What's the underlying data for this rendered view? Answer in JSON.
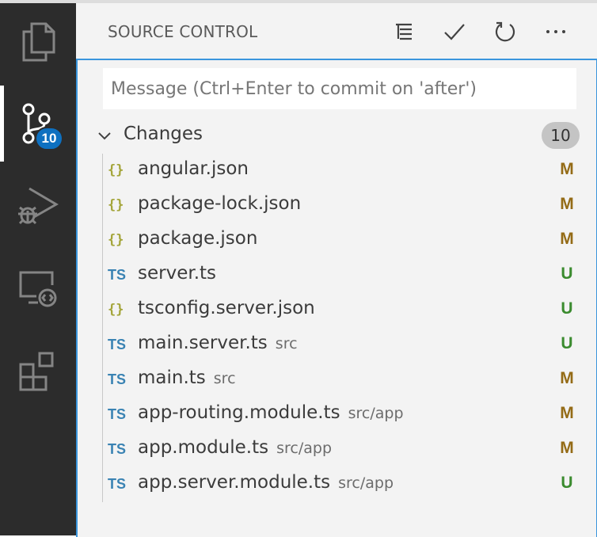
{
  "activity_bar": {
    "items": [
      {
        "name": "explorer",
        "icon": "files-icon"
      },
      {
        "name": "source-control",
        "icon": "source-control-icon",
        "badge": "10",
        "active": true
      },
      {
        "name": "run-and-debug",
        "icon": "debug-icon"
      },
      {
        "name": "remote-explorer",
        "icon": "remote-icon"
      },
      {
        "name": "extensions",
        "icon": "extensions-icon"
      }
    ]
  },
  "panel": {
    "title": "SOURCE CONTROL",
    "actions": [
      {
        "name": "view-as-tree",
        "icon": "list-tree-icon"
      },
      {
        "name": "commit",
        "icon": "check-icon"
      },
      {
        "name": "refresh",
        "icon": "refresh-icon"
      },
      {
        "name": "more-actions",
        "icon": "ellipsis-icon"
      }
    ]
  },
  "commit": {
    "placeholder": "Message (Ctrl+Enter to commit on 'after')",
    "value": ""
  },
  "changes": {
    "label": "Changes",
    "count": "10",
    "files": [
      {
        "icon": "{}",
        "kind": "json",
        "name": "angular.json",
        "dir": "",
        "status": "M"
      },
      {
        "icon": "{}",
        "kind": "json",
        "name": "package-lock.json",
        "dir": "",
        "status": "M"
      },
      {
        "icon": "{}",
        "kind": "json",
        "name": "package.json",
        "dir": "",
        "status": "M"
      },
      {
        "icon": "TS",
        "kind": "ts",
        "name": "server.ts",
        "dir": "",
        "status": "U"
      },
      {
        "icon": "{}",
        "kind": "json",
        "name": "tsconfig.server.json",
        "dir": "",
        "status": "U"
      },
      {
        "icon": "TS",
        "kind": "ts",
        "name": "main.server.ts",
        "dir": "src",
        "status": "U"
      },
      {
        "icon": "TS",
        "kind": "ts",
        "name": "main.ts",
        "dir": "src",
        "status": "M"
      },
      {
        "icon": "TS",
        "kind": "ts",
        "name": "app-routing.module.ts",
        "dir": "src/app",
        "status": "M"
      },
      {
        "icon": "TS",
        "kind": "ts",
        "name": "app.module.ts",
        "dir": "src/app",
        "status": "M"
      },
      {
        "icon": "TS",
        "kind": "ts",
        "name": "app.server.module.ts",
        "dir": "src/app",
        "status": "U"
      }
    ]
  },
  "colors": {
    "modified": "#946b16",
    "untracked": "#3b8b2f",
    "accent": "#0e70c0"
  }
}
